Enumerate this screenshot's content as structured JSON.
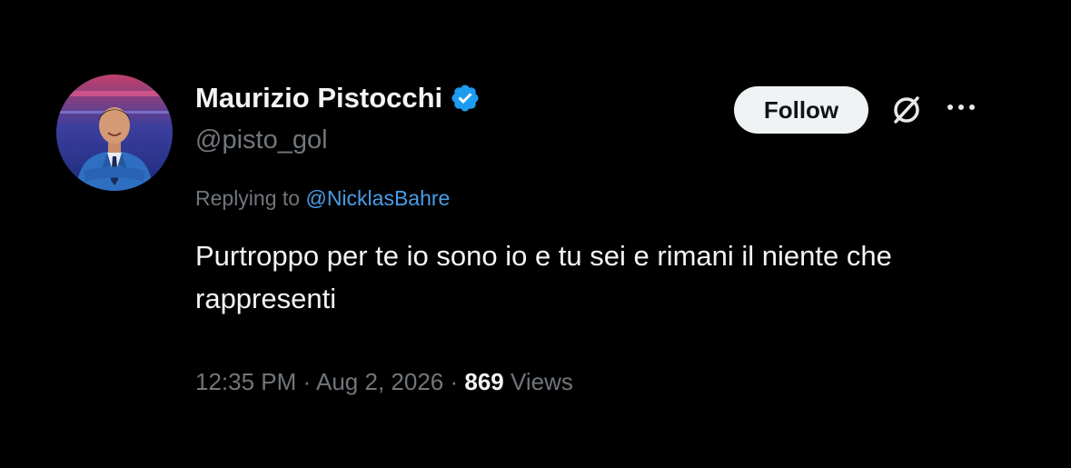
{
  "author": {
    "name": "Maurizio Pistocchi",
    "handle": "@pisto_gol",
    "verified": true,
    "verified_color": "#1d9bf0"
  },
  "actions": {
    "follow_label": "Follow",
    "grok_icon": "grok-icon",
    "more_icon": "more-icon"
  },
  "reply": {
    "prefix": "Replying to",
    "mention": "@NicklasBahre",
    "mention_color": "#4a9de8"
  },
  "tweet": {
    "text": "Purtroppo per te io sono io e tu sei e rimani il niente che rappresenti"
  },
  "meta": {
    "time": "12:35 PM",
    "date": "Aug 2, 2026",
    "separator": "·",
    "views_count": "869",
    "views_label": "Views"
  },
  "colors": {
    "background": "#000000",
    "primary_text": "#f2f4f5",
    "secondary_text": "#71767b",
    "follow_bg": "#eff3f4"
  }
}
